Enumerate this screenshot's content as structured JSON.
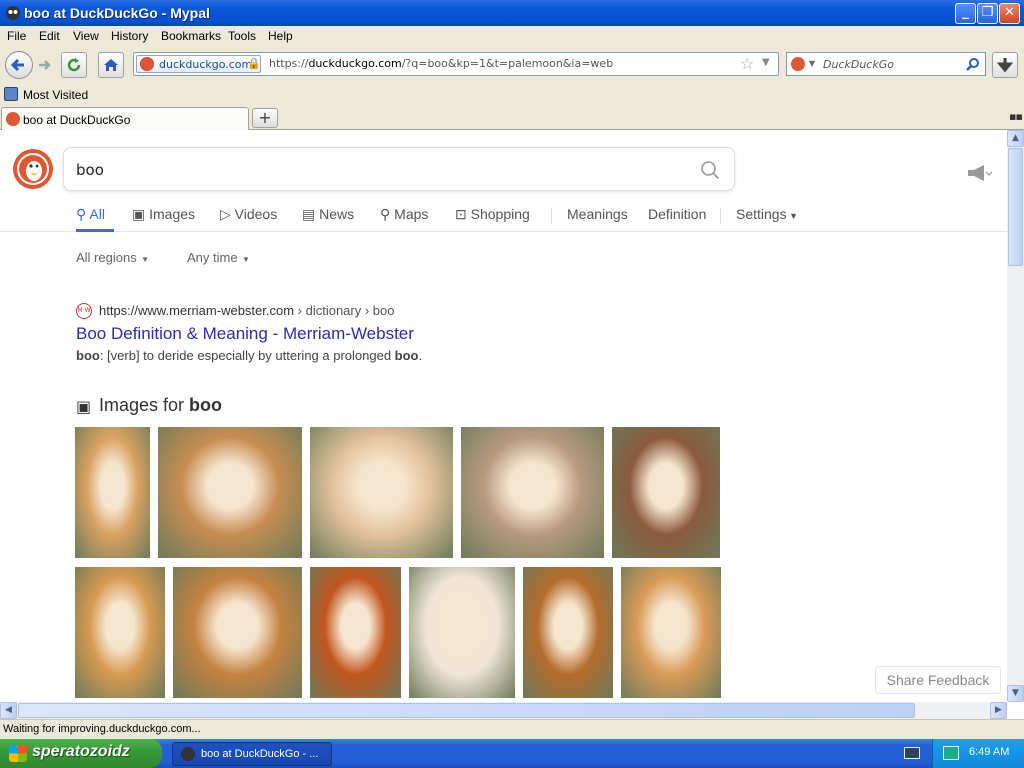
{
  "window": {
    "title": "boo at DuckDuckGo - Mypal"
  },
  "menu": [
    "File",
    "Edit",
    "View",
    "History",
    "Bookmarks",
    "Tools",
    "Help"
  ],
  "navbar": {
    "identity": "duckduckgo.com",
    "url_prefix": "https://",
    "url_host": "duckduckgo.com",
    "url_rest": "/?q=boo&kp=1&t=palemoon&ia=web",
    "search_placeholder": "DuckDuckGo"
  },
  "bookmarks": {
    "most_visited": "Most Visited"
  },
  "tab": {
    "label": "boo at DuckDuckGo"
  },
  "ddg": {
    "query": "boo",
    "nav": [
      "All",
      "Images",
      "Videos",
      "News",
      "Maps",
      "Shopping",
      "Meanings",
      "Definition",
      "Settings"
    ],
    "filters": [
      "All regions",
      "Any time"
    ],
    "result": {
      "url": "https://www.merriam-webster.com",
      "path": " › dictionary › boo",
      "title": "Boo Definition & Meaning - Merriam-Webster",
      "snippet_bold1": "boo",
      "snippet_mid": ": [verb] to deride especially by uttering a prolonged ",
      "snippet_bold2": "boo",
      "snippet_end": "."
    },
    "images_heading": "Images for ",
    "images_heading_bold": "boo",
    "image_colors": [
      "#d9a262",
      "#c68d52",
      "#e3c29d",
      "#b89a80",
      "#8a5a3e",
      "#d69a50",
      "#c48240",
      "#c2561e",
      "#efe5d8",
      "#b56c2c",
      "#d99b58"
    ],
    "feedback": "Share Feedback"
  },
  "status": "Waiting for improving.duckduckgo.com...",
  "taskbar": {
    "start": "speratozoidz",
    "task": "boo at DuckDuckGo - ...",
    "clock": "6:49 AM"
  }
}
